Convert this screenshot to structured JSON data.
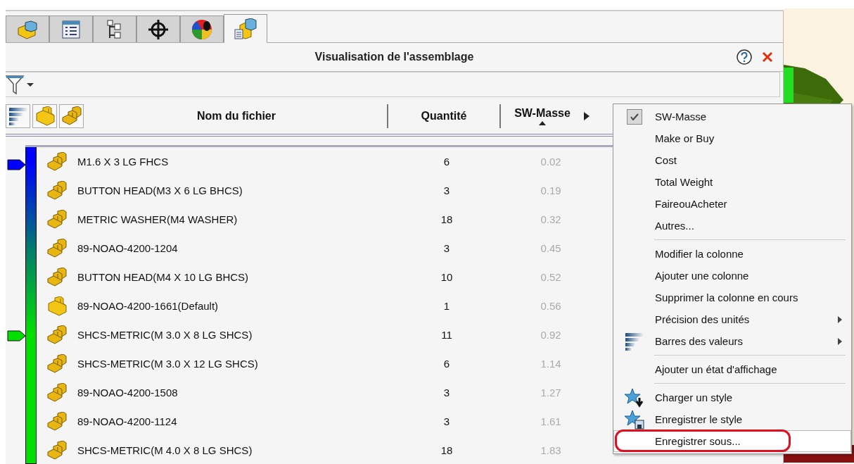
{
  "tabs": [
    {
      "selected": false
    },
    {
      "selected": false
    },
    {
      "selected": false
    },
    {
      "selected": false
    },
    {
      "selected": false
    },
    {
      "selected": true
    }
  ],
  "panel": {
    "title": "Visualisation de l'assemblage"
  },
  "table": {
    "columns": [
      "Nom du fichier",
      "Quantité",
      "SW-Masse"
    ],
    "rows": [
      {
        "kind": "assembly",
        "name": "M1.6 X 3 LG FHCS",
        "quantity": "6",
        "mass": "0.02",
        "marker": {
          "color": "#0000ff"
        }
      },
      {
        "kind": "assembly",
        "name": "BUTTON HEAD(M3 X 6 LG BHCS)",
        "quantity": "3",
        "mass": "0.19"
      },
      {
        "kind": "assembly",
        "name": "METRIC WASHER(M4 WASHER)",
        "quantity": "18",
        "mass": "0.32"
      },
      {
        "kind": "assembly",
        "name": "89-NOAO-4200-1204",
        "quantity": "3",
        "mass": "0.45"
      },
      {
        "kind": "assembly",
        "name": "BUTTON HEAD(M4 X 10 LG BHCS)",
        "quantity": "10",
        "mass": "0.52"
      },
      {
        "kind": "part",
        "name": "89-NOAO-4200-1661(Default)",
        "quantity": "1",
        "mass": "0.56"
      },
      {
        "kind": "assembly",
        "name": "SHCS-METRIC(M 3.0  X 8 LG SHCS)",
        "quantity": "11",
        "mass": "0.92",
        "marker": {
          "color": "#00e000"
        }
      },
      {
        "kind": "assembly",
        "name": "SHCS-METRIC(M 3.0  X 12 LG SHCS)",
        "quantity": "6",
        "mass": "1.14"
      },
      {
        "kind": "assembly",
        "name": "89-NOAO-4200-1508",
        "quantity": "3",
        "mass": "1.27"
      },
      {
        "kind": "assembly",
        "name": "89-NOAO-4200-1124",
        "quantity": "3",
        "mass": "1.61"
      },
      {
        "kind": "assembly",
        "name": "SHCS-METRIC(M 4.0 X 8 LG SHCS)",
        "quantity": "18",
        "mass": "1.83"
      }
    ]
  },
  "context_menu": {
    "items": [
      {
        "kind": "column",
        "label": "SW-Masse",
        "checked": true,
        "selected": false
      },
      {
        "kind": "column",
        "label": "Make or Buy",
        "checked": false,
        "selected": false
      },
      {
        "kind": "column",
        "label": "Cost",
        "checked": false,
        "selected": false
      },
      {
        "kind": "column",
        "label": "Total Weight",
        "checked": false,
        "selected": false
      },
      {
        "kind": "column",
        "label": "FaireouAcheter",
        "checked": false,
        "selected": false
      },
      {
        "kind": "action",
        "label": "Autres...",
        "selected": false
      },
      {
        "kind": "separator"
      },
      {
        "kind": "action",
        "label": "Modifier la colonne",
        "selected": false
      },
      {
        "kind": "action",
        "label": "Ajouter une colonne",
        "selected": false
      },
      {
        "kind": "action",
        "label": "Supprimer la colonne en cours",
        "selected": false
      },
      {
        "kind": "submenu",
        "label": "Précision des unités",
        "selected": false
      },
      {
        "kind": "submenu",
        "label": "Barres des valeurs",
        "selected": false
      },
      {
        "kind": "separator"
      },
      {
        "kind": "action",
        "label": "Ajouter un état d'affichage",
        "selected": false
      },
      {
        "kind": "separator"
      },
      {
        "kind": "action",
        "label": "Charger un style",
        "selected": false
      },
      {
        "kind": "action",
        "label": "Enregistrer le style",
        "selected": false
      },
      {
        "kind": "action",
        "label": "Enregistrer sous...",
        "selected": true,
        "circled": true
      }
    ]
  }
}
